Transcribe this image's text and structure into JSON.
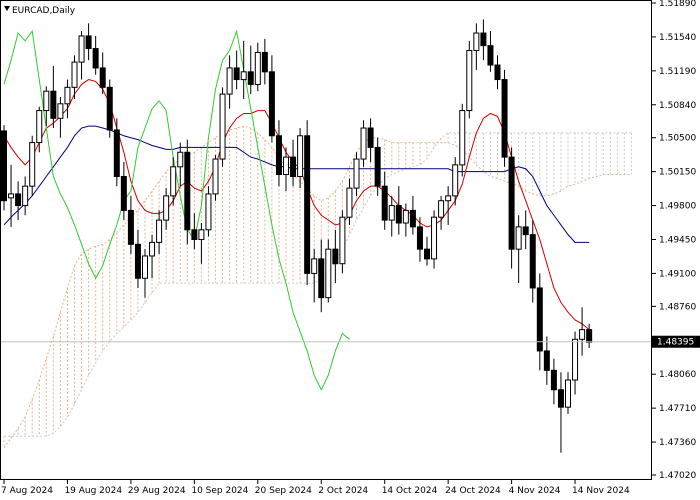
{
  "symbol_label": "EURCAD,Daily",
  "current_price": "1.48395",
  "chart_data": {
    "type": "candlestick",
    "title": "EURCAD,Daily",
    "ylim": [
      1.4702,
      1.5189
    ],
    "y_ticks": [
      "1.51890",
      "1.51540",
      "1.51190",
      "1.50840",
      "1.50500",
      "1.50150",
      "1.49800",
      "1.49450",
      "1.49100",
      "1.48760",
      "1.48395",
      "1.48060",
      "1.47710",
      "1.47360",
      "1.47020"
    ],
    "x_tick_labels": [
      "7 Aug 2024",
      "19 Aug 2024",
      "29 Aug 2024",
      "10 Sep 2024",
      "20 Sep 2024",
      "2 Oct 2024",
      "14 Oct 2024",
      "24 Oct 2024",
      "4 Nov 2024",
      "14 Nov 2024"
    ],
    "candles": [
      [
        1.5057,
        1.5063,
        1.4975,
        1.4985
      ],
      [
        1.4988,
        1.5022,
        1.4958,
        1.4992
      ],
      [
        1.4992,
        1.5005,
        1.4965,
        1.498
      ],
      [
        1.498,
        1.501,
        1.497,
        1.5
      ],
      [
        1.5,
        1.5052,
        1.499,
        1.5045
      ],
      [
        1.5045,
        1.5082,
        1.5035,
        1.5078
      ],
      [
        1.5078,
        1.5103,
        1.5062,
        1.5098
      ],
      [
        1.5098,
        1.5124,
        1.506,
        1.507
      ],
      [
        1.507,
        1.5092,
        1.505,
        1.5085
      ],
      [
        1.5085,
        1.511,
        1.507,
        1.5102
      ],
      [
        1.5102,
        1.5135,
        1.509,
        1.5128
      ],
      [
        1.5128,
        1.516,
        1.511,
        1.5155
      ],
      [
        1.5155,
        1.5168,
        1.513,
        1.5142
      ],
      [
        1.5142,
        1.5155,
        1.5115,
        1.5122
      ],
      [
        1.5122,
        1.5138,
        1.5095,
        1.5102
      ],
      [
        1.5102,
        1.511,
        1.505,
        1.5058
      ],
      [
        1.5058,
        1.507,
        1.5,
        1.501
      ],
      [
        1.501,
        1.5025,
        1.4965,
        1.4975
      ],
      [
        1.4975,
        1.499,
        1.493,
        1.494
      ],
      [
        1.494,
        1.4955,
        1.4895,
        1.4905
      ],
      [
        1.4905,
        1.4935,
        1.4885,
        1.4928
      ],
      [
        1.4928,
        1.495,
        1.4905,
        1.4942
      ],
      [
        1.4942,
        1.4975,
        1.493,
        1.4965
      ],
      [
        1.4965,
        1.4998,
        1.4955,
        1.499
      ],
      [
        1.499,
        1.503,
        1.498,
        1.502
      ],
      [
        1.502,
        1.5045,
        1.5,
        1.5035
      ],
      [
        1.5035,
        1.5048,
        1.494,
        1.4955
      ],
      [
        1.4955,
        1.4972,
        1.4935,
        1.4945
      ],
      [
        1.4945,
        1.4962,
        1.492,
        1.4955
      ],
      [
        1.4955,
        1.5,
        1.4948,
        1.4992
      ],
      [
        1.4992,
        1.5032,
        1.4985,
        1.5028
      ],
      [
        1.5028,
        1.5102,
        1.502,
        1.5095
      ],
      [
        1.5095,
        1.5135,
        1.508,
        1.5122
      ],
      [
        1.5122,
        1.514,
        1.51,
        1.511
      ],
      [
        1.511,
        1.515,
        1.509,
        1.5118
      ],
      [
        1.5118,
        1.5145,
        1.5095,
        1.5105
      ],
      [
        1.5105,
        1.5148,
        1.5098,
        1.5138
      ],
      [
        1.5138,
        1.5152,
        1.5105,
        1.5118
      ],
      [
        1.5118,
        1.5135,
        1.5045,
        1.5052
      ],
      [
        1.5052,
        1.5068,
        1.5,
        1.5012
      ],
      [
        1.5012,
        1.504,
        1.4995,
        1.503
      ],
      [
        1.503,
        1.5048,
        1.5,
        1.501
      ],
      [
        1.501,
        1.506,
        1.4998,
        1.5052
      ],
      [
        1.5052,
        1.5068,
        1.4898,
        1.491
      ],
      [
        1.491,
        1.4935,
        1.488,
        1.4925
      ],
      [
        1.4925,
        1.4945,
        1.487,
        1.4885
      ],
      [
        1.4885,
        1.4945,
        1.488,
        1.4935
      ],
      [
        1.4935,
        1.4955,
        1.49,
        1.492
      ],
      [
        1.492,
        1.4975,
        1.491,
        1.4968
      ],
      [
        1.4968,
        1.5008,
        1.496,
        1.4998
      ],
      [
        1.4998,
        1.5035,
        1.499,
        1.5028
      ],
      [
        1.5028,
        1.5068,
        1.502,
        1.506
      ],
      [
        1.506,
        1.507,
        1.5025,
        1.504
      ],
      [
        1.504,
        1.505,
        1.499,
        1.5
      ],
      [
        1.5,
        1.5015,
        1.4955,
        1.4965
      ],
      [
        1.4965,
        1.499,
        1.4948,
        1.498
      ],
      [
        1.498,
        1.5,
        1.495,
        1.4962
      ],
      [
        1.4962,
        1.4982,
        1.4948,
        1.4975
      ],
      [
        1.4975,
        1.499,
        1.495,
        1.4958
      ],
      [
        1.4958,
        1.4968,
        1.4922,
        1.4935
      ],
      [
        1.4935,
        1.4948,
        1.4918,
        1.4925
      ],
      [
        1.4925,
        1.4975,
        1.4915,
        1.4968
      ],
      [
        1.4968,
        1.499,
        1.4955,
        1.4985
      ],
      [
        1.4985,
        1.5,
        1.496,
        1.499
      ],
      [
        1.499,
        1.503,
        1.498,
        1.5022
      ],
      [
        1.5022,
        1.5085,
        1.501,
        1.5078
      ],
      [
        1.5078,
        1.515,
        1.507,
        1.514
      ],
      [
        1.514,
        1.5168,
        1.512,
        1.5158
      ],
      [
        1.5158,
        1.5172,
        1.513,
        1.5145
      ],
      [
        1.5145,
        1.516,
        1.5118,
        1.5125
      ],
      [
        1.5125,
        1.5135,
        1.51,
        1.511
      ],
      [
        1.511,
        1.512,
        1.502,
        1.503
      ],
      [
        1.503,
        1.504,
        1.4915,
        1.4935
      ],
      [
        1.4935,
        1.497,
        1.49,
        1.4958
      ],
      [
        1.4958,
        1.4975,
        1.4935,
        1.495
      ],
      [
        1.495,
        1.4965,
        1.488,
        1.4895
      ],
      [
        1.4895,
        1.491,
        1.481,
        1.483
      ],
      [
        1.483,
        1.4845,
        1.4795,
        1.481
      ],
      [
        1.481,
        1.4822,
        1.4775,
        1.479
      ],
      [
        1.479,
        1.4808,
        1.4725,
        1.4772
      ],
      [
        1.4772,
        1.4808,
        1.4765,
        1.48
      ],
      [
        1.48,
        1.485,
        1.4785,
        1.4842
      ],
      [
        1.4842,
        1.4875,
        1.4825,
        1.4852
      ],
      [
        1.4852,
        1.4858,
        1.4833,
        1.4839
      ]
    ],
    "tenkan": [
      1.5052,
      1.504,
      1.503,
      1.5022,
      1.503,
      1.5045,
      1.506,
      1.5065,
      1.5072,
      1.508,
      1.5095,
      1.5105,
      1.511,
      1.5108,
      1.51,
      1.5085,
      1.506,
      1.5035,
      1.5005,
      1.4985,
      1.4975,
      1.4972,
      1.4972,
      1.4975,
      1.4985,
      1.5,
      1.5005,
      1.4998,
      1.4995,
      1.5005,
      1.502,
      1.5045,
      1.506,
      1.507,
      1.5075,
      1.5075,
      1.5078,
      1.5078,
      1.5065,
      1.505,
      1.5035,
      1.5025,
      1.5018,
      1.4998,
      1.498,
      1.497,
      1.4965,
      1.496,
      1.4962,
      1.497,
      1.4985,
      1.4995,
      1.5,
      1.5,
      1.4995,
      1.4988,
      1.498,
      1.4975,
      1.497,
      1.4962,
      1.4958,
      1.496,
      1.4965,
      1.4975,
      1.4985,
      1.5002,
      1.503,
      1.5055,
      1.507,
      1.5075,
      1.5072,
      1.5055,
      1.503,
      1.5005,
      1.4985,
      1.4965,
      1.4945,
      1.492,
      1.4895,
      1.488,
      1.487,
      1.4862,
      1.4858,
      1.4852
    ],
    "kijun": [
      1.496,
      1.4968,
      1.4975,
      1.4982,
      1.499,
      1.5,
      1.501,
      1.502,
      1.503,
      1.504,
      1.5052,
      1.506,
      1.5062,
      1.5062,
      1.506,
      1.5058,
      1.5055,
      1.5052,
      1.505,
      1.5048,
      1.5045,
      1.5042,
      1.504,
      1.5038,
      1.5038,
      1.504,
      1.504,
      1.504,
      1.504,
      1.504,
      1.504,
      1.504,
      1.504,
      1.504,
      1.5035,
      1.503,
      1.5028,
      1.5025,
      1.5022,
      1.502,
      1.502,
      1.5018,
      1.5018,
      1.5018,
      1.5018,
      1.5018,
      1.5018,
      1.5018,
      1.5018,
      1.5018,
      1.5018,
      1.5018,
      1.5018,
      1.5018,
      1.5018,
      1.5018,
      1.5018,
      1.5018,
      1.5018,
      1.5018,
      1.5018,
      1.5018,
      1.5018,
      1.5018,
      1.5015,
      1.5015,
      1.5015,
      1.5015,
      1.5015,
      1.5015,
      1.5015,
      1.5015,
      1.5018,
      1.502,
      1.5018,
      1.501,
      1.4995,
      1.498,
      1.497,
      1.496,
      1.495,
      1.4942,
      1.4942,
      1.4942
    ],
    "chikou": [
      1.5105,
      1.513,
      1.5158,
      1.515,
      1.516,
      1.511,
      1.506,
      1.501,
      1.4992,
      1.4978,
      1.496,
      1.494,
      1.492,
      1.4905,
      1.4918,
      1.494,
      1.496,
      1.4985,
      1.4995,
      1.504,
      1.506,
      1.508,
      1.5088,
      1.5078,
      1.503,
      1.499,
      1.4955,
      1.4945,
      1.498,
      1.505,
      1.51,
      1.513,
      1.514,
      1.516,
      1.512,
      1.508,
      1.504,
      1.5,
      1.496,
      1.4925,
      1.49,
      1.487,
      1.485,
      1.483,
      1.4805,
      1.479,
      1.4805,
      1.483,
      1.4848,
      1.4842
    ],
    "span_a": [
      1.473,
      1.474,
      1.475,
      1.4762,
      1.478,
      1.48,
      1.4822,
      1.4845,
      1.487,
      1.4895,
      1.4918,
      1.493,
      1.4935,
      1.4938,
      1.494,
      1.4945,
      1.4952,
      1.496,
      1.4968,
      1.4975,
      1.4985,
      1.4995,
      1.5005,
      1.5015,
      1.5022,
      1.5028,
      1.5032,
      1.5035,
      1.504,
      1.5045,
      1.505,
      1.5055,
      1.5058,
      1.506,
      1.5062,
      1.506,
      1.5055,
      1.5048,
      1.504,
      1.503,
      1.502,
      1.5012,
      1.5005,
      1.4998,
      1.499,
      1.4985,
      1.4988,
      1.4995,
      1.5005,
      1.502,
      1.5035,
      1.5045,
      1.505,
      1.505,
      1.5048,
      1.5045,
      1.5045,
      1.5045,
      1.5045,
      1.5045,
      1.5045,
      1.5045,
      1.5045,
      1.5045,
      1.5042,
      1.5038,
      1.503,
      1.5022,
      1.5015,
      1.501,
      1.5008,
      1.5005,
      1.5003,
      1.5,
      1.4995,
      1.4992,
      1.499,
      1.499,
      1.4992,
      1.4995,
      1.5,
      1.5002,
      1.5005,
      1.5008,
      1.501,
      1.5012,
      1.5012,
      1.5012,
      1.5012,
      1.5012
    ],
    "span_b": [
      1.4742,
      1.4742,
      1.4742,
      1.4742,
      1.4742,
      1.4742,
      1.4742,
      1.4745,
      1.4752,
      1.4762,
      1.4775,
      1.479,
      1.4805,
      1.4818,
      1.483,
      1.484,
      1.4848,
      1.4855,
      1.4862,
      1.487,
      1.488,
      1.489,
      1.49,
      1.49,
      1.49,
      1.49,
      1.49,
      1.49,
      1.49,
      1.49,
      1.49,
      1.49,
      1.49,
      1.49,
      1.49,
      1.49,
      1.49,
      1.49,
      1.49,
      1.49,
      1.49,
      1.49,
      1.49,
      1.49,
      1.49,
      1.4905,
      1.4912,
      1.4922,
      1.4935,
      1.495,
      1.4965,
      1.4978,
      1.499,
      1.5,
      1.5008,
      1.5012,
      1.5015,
      1.5018,
      1.502,
      1.5022,
      1.5028,
      1.504,
      1.505,
      1.5055,
      1.5055,
      1.5055,
      1.5055,
      1.5055,
      1.5055,
      1.5055,
      1.5055,
      1.5055,
      1.5055,
      1.5055,
      1.5055,
      1.5055,
      1.5055,
      1.5055,
      1.5055,
      1.5055,
      1.5055,
      1.5055,
      1.5055,
      1.5055,
      1.5055,
      1.5055,
      1.5055,
      1.5055,
      1.5055,
      1.5055
    ]
  }
}
